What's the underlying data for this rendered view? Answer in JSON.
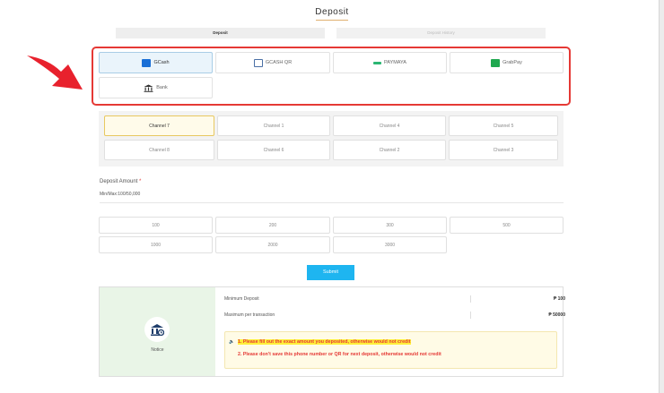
{
  "page": {
    "title": "Deposit"
  },
  "tabs": [
    {
      "label": "Deposit",
      "active": true
    },
    {
      "label": "Deposit History",
      "active": false
    }
  ],
  "methods": [
    {
      "label": "GCash",
      "icon": "gcash-icon",
      "selected": true
    },
    {
      "label": "GCASH QR",
      "icon": "qr-icon",
      "selected": false
    },
    {
      "label": "PAYMAYA",
      "icon": "paymaya-icon",
      "selected": false
    },
    {
      "label": "GrabPay",
      "icon": "grabpay-icon",
      "selected": false
    },
    {
      "label": "Bank",
      "icon": "bank-icon",
      "selected": false
    }
  ],
  "channels": [
    {
      "label": "Channel 7",
      "selected": true
    },
    {
      "label": "Channel 1",
      "selected": false
    },
    {
      "label": "Channel 4",
      "selected": false
    },
    {
      "label": "Channel 5",
      "selected": false
    },
    {
      "label": "Channel 8",
      "selected": false
    },
    {
      "label": "Channel 6",
      "selected": false
    },
    {
      "label": "Channel 2",
      "selected": false
    },
    {
      "label": "Channel 3",
      "selected": false
    }
  ],
  "deposit_amount": {
    "label": "Deposit Amount",
    "required_mark": "*",
    "placeholder": "Min/Max:100/50,000"
  },
  "amounts": [
    "100",
    "200",
    "300",
    "500",
    "1000",
    "2000",
    "3000"
  ],
  "submit_label": "Submit",
  "notice": {
    "label": "Notice",
    "min_deposit_label": "Minimum Deposit",
    "min_deposit_value": "₱ 100",
    "max_label": "Maximum per transaction",
    "max_value": "₱ 50000",
    "warning_1": "1. Please fill out the exact amount you deposited, otherwise would not credit",
    "warning_2": "2. Please don't save this phone number or QR for next deposit, otherwise would not credit"
  },
  "colors": {
    "accent": "#1eb5f0",
    "highlight_border": "#e53935",
    "notice_bg": "#e9f5e7"
  }
}
